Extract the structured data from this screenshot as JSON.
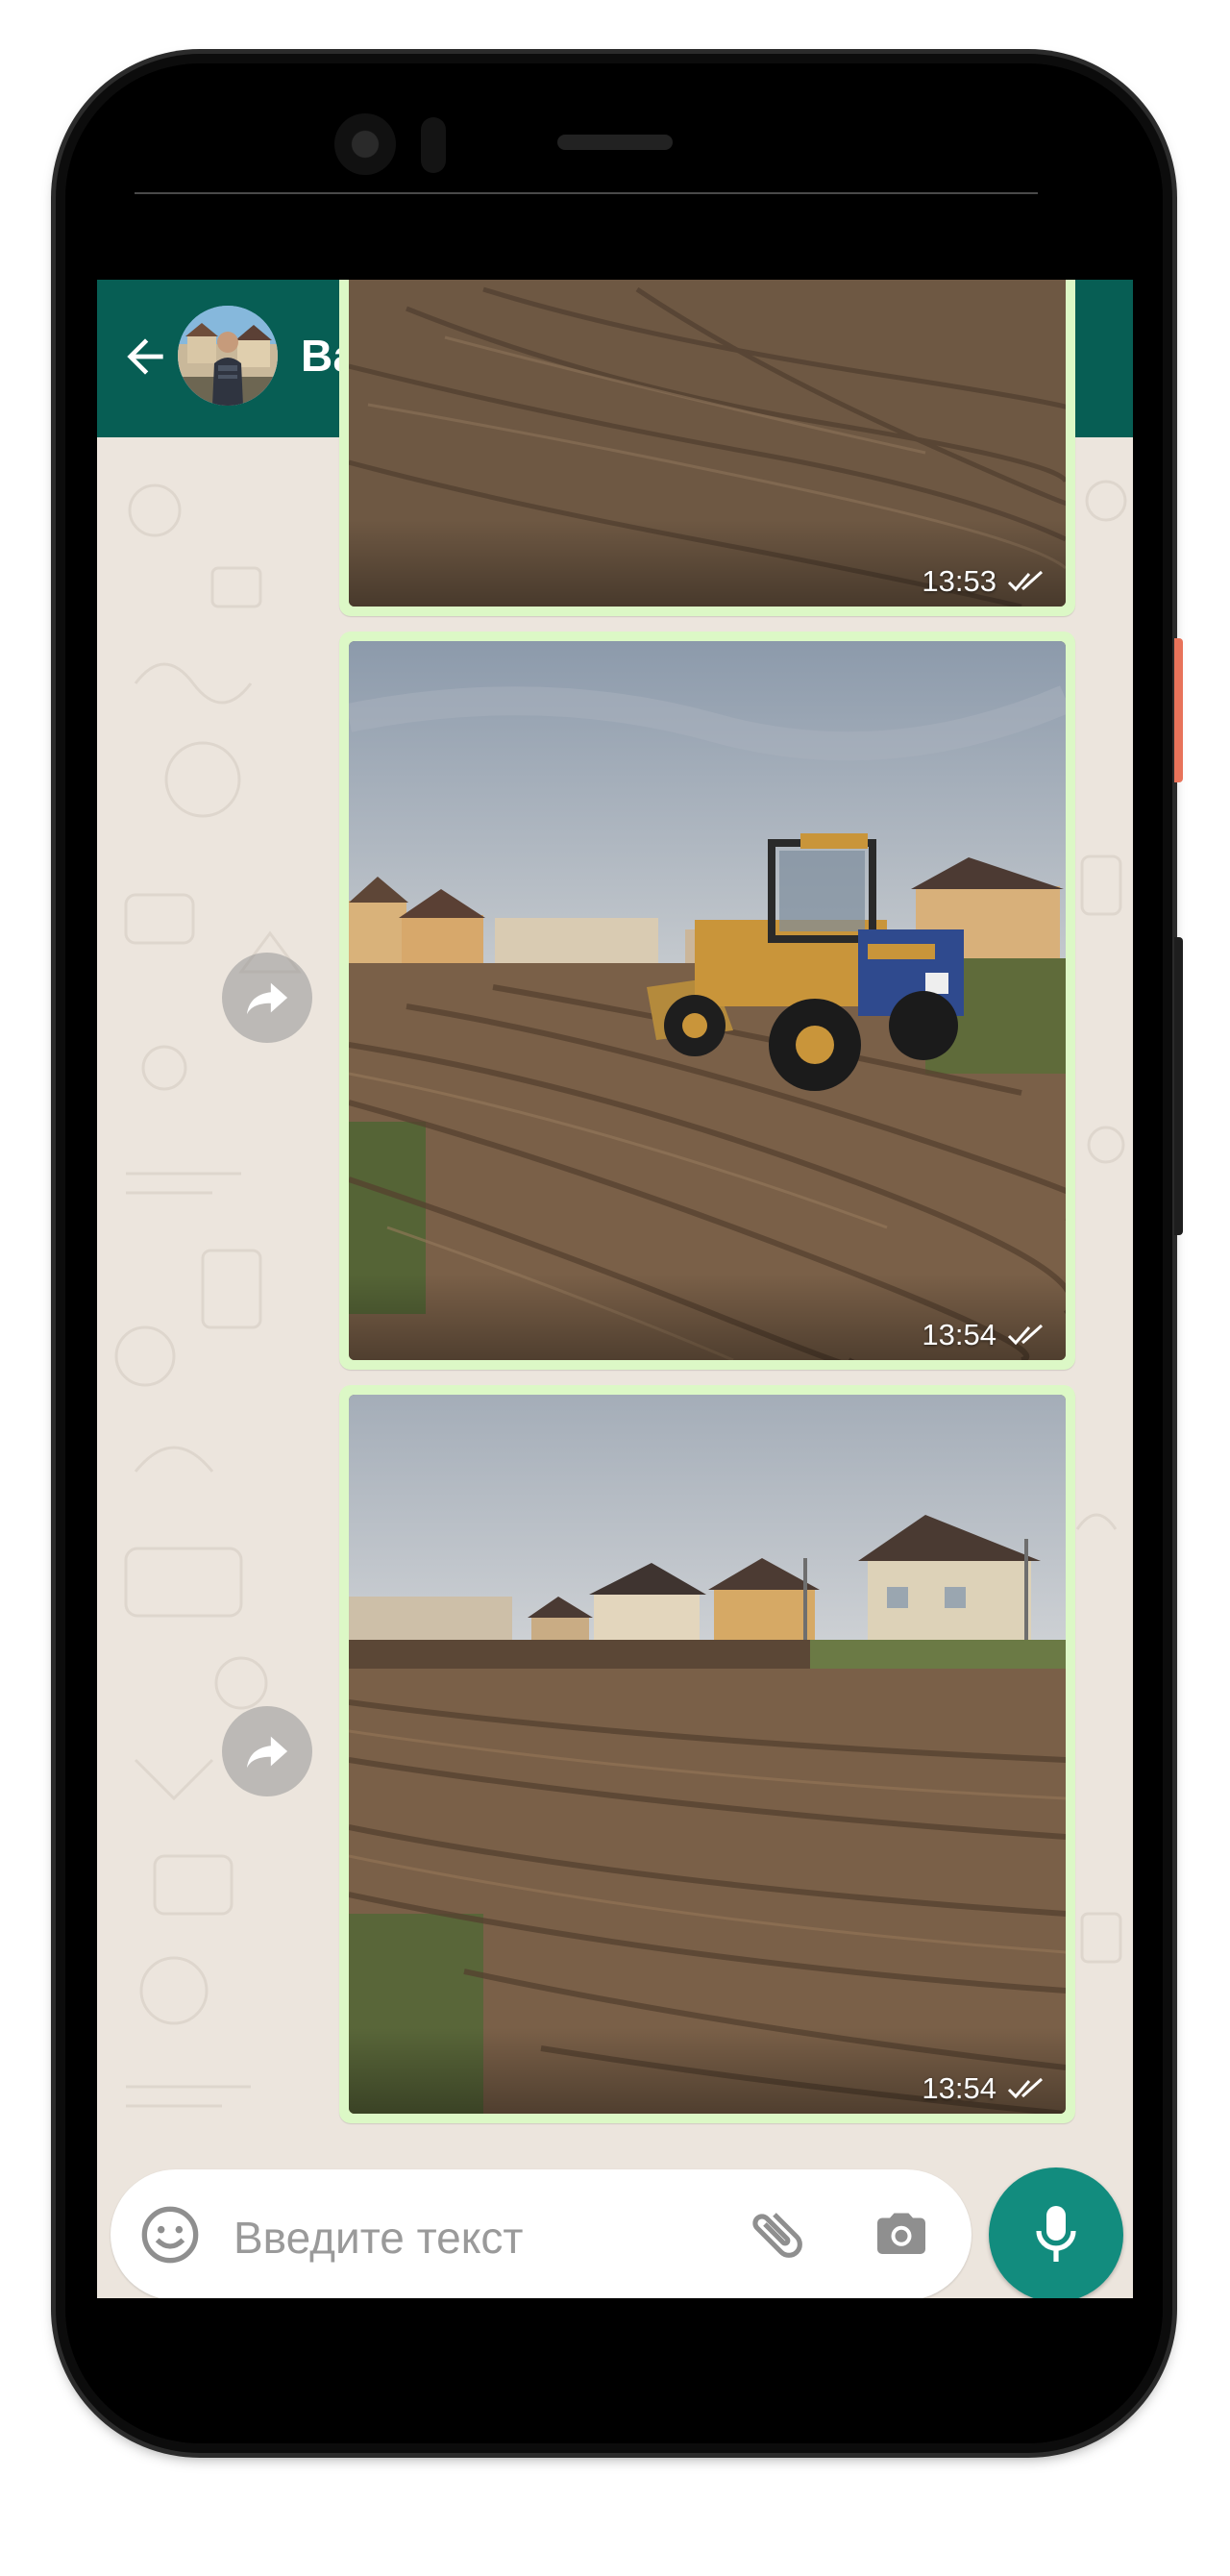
{
  "header": {
    "contact_name": "Вадим",
    "background_color": "#075e54",
    "icons": [
      "back-arrow-icon",
      "video-call-icon",
      "phone-icon",
      "more-options-icon"
    ]
  },
  "messages": [
    {
      "type": "image",
      "time": "13:53",
      "status": "read",
      "status_icon": "double-check-icon",
      "photo_subject": "tracked dirt field"
    },
    {
      "type": "image",
      "time": "13:54",
      "status": "read",
      "status_icon": "double-check-icon",
      "photo_subject": "wheel loader on dirt field"
    },
    {
      "type": "image",
      "time": "13:54",
      "status": "read",
      "status_icon": "double-check-icon",
      "photo_subject": "levelled dirt field with houses"
    }
  ],
  "composer": {
    "placeholder": "Введите текст",
    "icons": [
      "emoji-icon",
      "attach-icon",
      "camera-icon",
      "mic-icon"
    ],
    "mic_color": "#128c7e"
  },
  "colors": {
    "chat_background": "#ece5dd",
    "outgoing_bubble": "#dcf8c6"
  }
}
